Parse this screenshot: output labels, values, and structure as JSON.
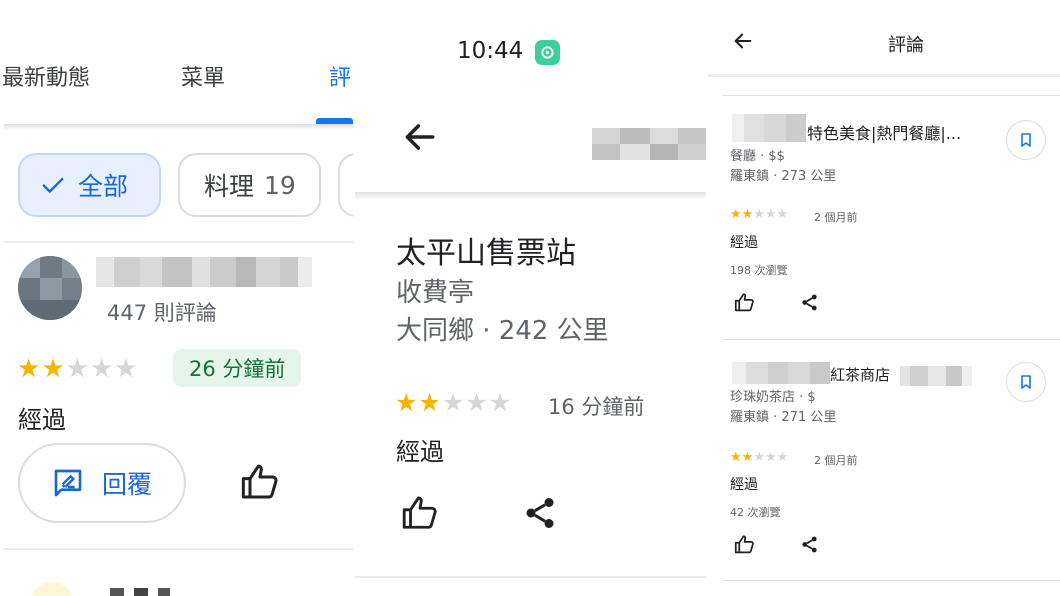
{
  "panel1": {
    "tabs": [
      "最新動態",
      "菜單",
      "評"
    ],
    "chips": [
      {
        "label": "全部",
        "selected": true
      },
      {
        "label": "料理",
        "count": "19"
      }
    ],
    "review": {
      "reviewer_stats": "447 則評論",
      "rating": 2,
      "max_rating": 5,
      "time": "26 分鐘前",
      "text": "經過",
      "reply_label": "回覆"
    },
    "icons": [
      "check-icon",
      "reply-icon",
      "thumb-up-icon"
    ]
  },
  "panel2": {
    "status_time": "10:44",
    "place": {
      "name": "太平山售票站",
      "category": "收費亭",
      "location": "大同鄉 · 242 公里"
    },
    "review": {
      "rating": 2,
      "max_rating": 5,
      "time": "16 分鐘前",
      "text": "經過"
    },
    "icons": [
      "back-arrow-icon",
      "thumb-up-icon",
      "share-icon"
    ]
  },
  "panel3": {
    "header_title": "評論",
    "reviews": [
      {
        "place_name": "特色美食|熱門餐廳|...",
        "category": "餐廳 · $$",
        "location": "羅東鎮 · 273 公里",
        "rating": 2,
        "time": "2 個月前",
        "text": "經過",
        "views": "198 次瀏覽"
      },
      {
        "place_name": "紅茶商店",
        "category": "珍珠奶茶店 · $",
        "location": "羅東鎮 · 271 公里",
        "rating": 2,
        "time": "2 個月前",
        "text": "經過",
        "views": "42 次瀏覽"
      }
    ],
    "icons": [
      "back-arrow-icon",
      "bookmark-icon",
      "thumb-up-icon",
      "share-icon"
    ]
  },
  "colors": {
    "accent": "#1a73e8",
    "star_filled": "#f6b400",
    "star_empty": "#d6d6d6",
    "badge_bg": "#e6f4ea",
    "badge_text": "#137333"
  }
}
